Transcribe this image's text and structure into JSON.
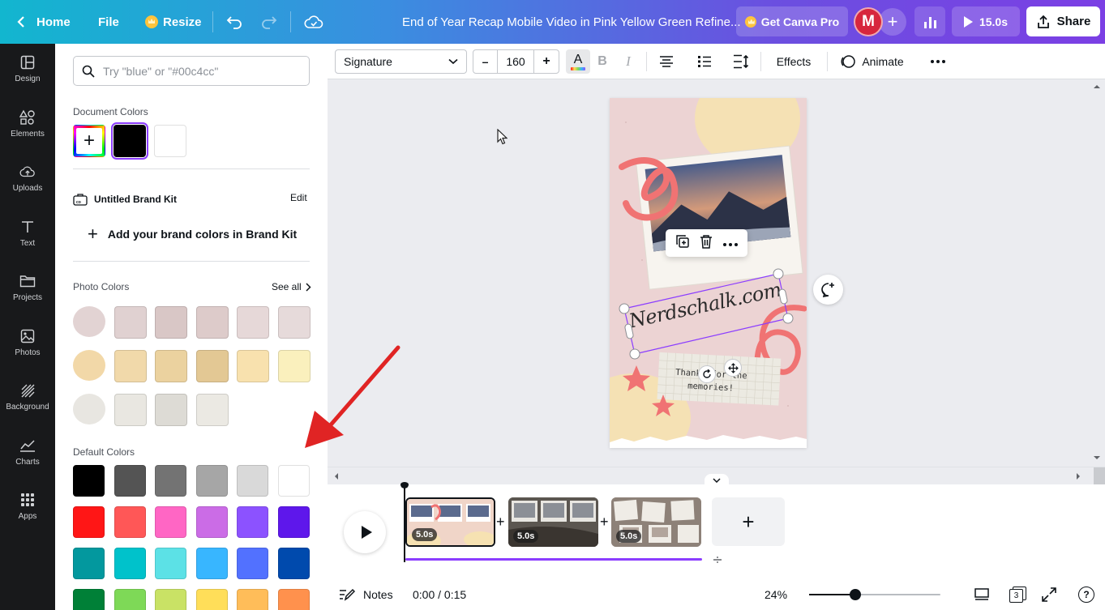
{
  "topbar": {
    "home": "Home",
    "file": "File",
    "resize": "Resize",
    "title": "End of Year Recap Mobile Video in Pink Yellow Green Refine...",
    "get_pro": "Get Canva Pro",
    "avatar_initial": "M",
    "duration": "15.0s",
    "share": "Share"
  },
  "rail": [
    {
      "label": "Design",
      "icon": "layout-icon"
    },
    {
      "label": "Elements",
      "icon": "shapes-icon"
    },
    {
      "label": "Uploads",
      "icon": "cloud-upload-icon"
    },
    {
      "label": "Text",
      "icon": "text-icon"
    },
    {
      "label": "Projects",
      "icon": "folder-icon"
    },
    {
      "label": "Photos",
      "icon": "image-icon"
    },
    {
      "label": "Background",
      "icon": "pattern-icon"
    },
    {
      "label": "Charts",
      "icon": "chart-icon"
    },
    {
      "label": "Apps",
      "icon": "grid-icon"
    }
  ],
  "panel": {
    "search_placeholder": "Try \"blue\" or \"#00c4cc\"",
    "document_colors_title": "Document Colors",
    "document_colors": [
      "#000000",
      "#ffffff"
    ],
    "brand_kit": "Untitled Brand Kit",
    "brand_edit": "Edit",
    "add_brand": "Add your brand colors in Brand Kit",
    "photo_colors_title": "Photo Colors",
    "see_all": "See all",
    "photo_colors": [
      [
        "#e2d3d3",
        "#e0d1d1",
        "#d9c7c6",
        "#ddcbca",
        "#e6d8d8",
        "#e6dada"
      ],
      [
        "#f2d8a8",
        "#f1d9aa",
        "#ebd29f",
        "#e3c894",
        "#f8e1ae",
        "#faf0bd"
      ],
      [
        "#e8e6e1",
        "#e9e7e1",
        "#dddbd5",
        "#ebe9e3"
      ]
    ],
    "default_colors_title": "Default Colors",
    "default_colors": [
      [
        "#000000",
        "#545454",
        "#737373",
        "#a6a6a6",
        "#d9d9d9",
        "#ffffff"
      ],
      [
        "#ff1616",
        "#ff5757",
        "#ff66c4",
        "#cb6ce6",
        "#8c52ff",
        "#5e17eb"
      ],
      [
        "#03989e",
        "#00c2cb",
        "#5ce1e6",
        "#38b6ff",
        "#5271ff",
        "#004aad"
      ],
      [
        "#008037",
        "#7ed957",
        "#c9e265",
        "#ffde59",
        "#ffbd59",
        "#ff914d"
      ]
    ]
  },
  "toolbar": {
    "font": "Signature",
    "minus": "–",
    "size": "160",
    "plus": "+",
    "bold": "B",
    "italic": "I",
    "effects": "Effects",
    "animate": "Animate",
    "text_color": "#0e1318"
  },
  "canvas": {
    "signature_text": "Nerdschalk.com",
    "thanks_text": "Thanks for the memories!"
  },
  "timeline": {
    "clips": [
      {
        "duration": "5.0s"
      },
      {
        "duration": "5.0s"
      },
      {
        "duration": "5.0s"
      }
    ],
    "add": "+"
  },
  "footer": {
    "notes": "Notes",
    "time": "0:00 / 0:15",
    "zoom": "24%",
    "zoom_level": 0.24,
    "pages": "3"
  }
}
